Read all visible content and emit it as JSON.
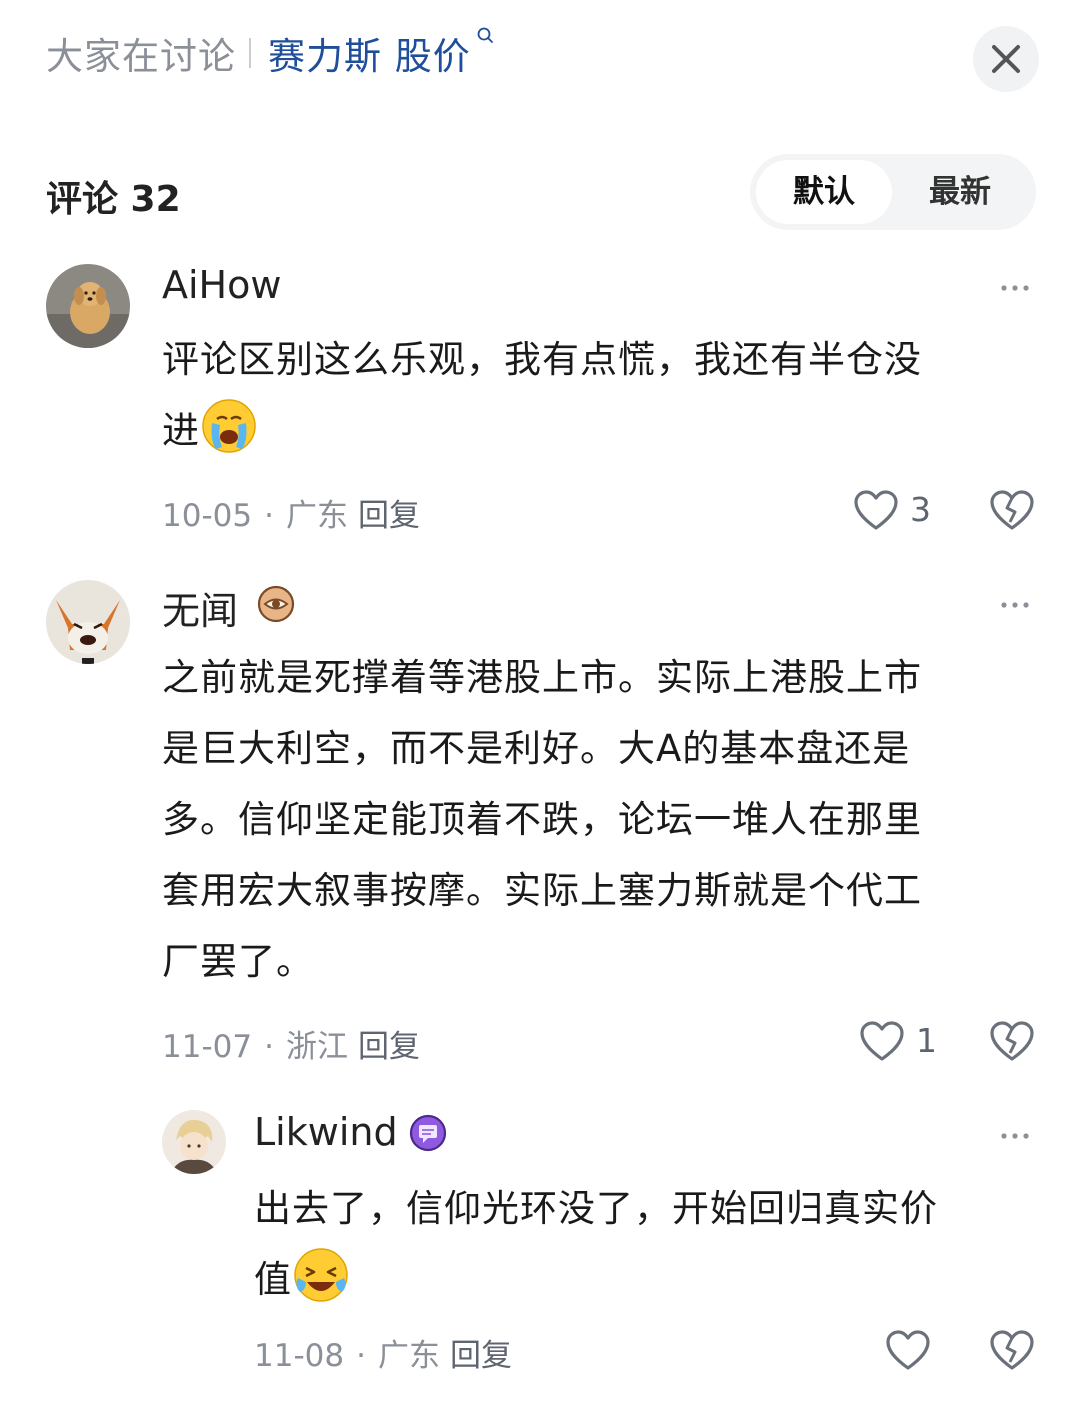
{
  "header": {
    "topic_prefix": "大家在讨论",
    "topic_query": "赛力斯 股价"
  },
  "comments_header": {
    "title": "评论 32",
    "sort_default": "默认",
    "sort_latest": "最新"
  },
  "comments": [
    {
      "username": "AiHow",
      "text_line1": "评论区别这么乐观，我有点慌，我还有半仓没",
      "text_line2": "进",
      "date": "10-05",
      "location": "广东",
      "reply_label": "回复",
      "likes": "3"
    },
    {
      "username": "无闻",
      "lines": [
        "之前就是死撑着等港股上市。实际上港股上市",
        "是巨大利空，而不是利好。大A的基本盘还是",
        "多。信仰坚定能顶着不跌，论坛一堆人在那里",
        "套用宏大叙事按摩。实际上塞力斯就是个代工",
        "厂罢了。"
      ],
      "date": "11-07",
      "location": "浙江",
      "reply_label": "回复",
      "likes": "1"
    },
    {
      "username": "Likwind",
      "text_line1": "出去了，信仰光环没了，开始回归真实价",
      "text_line2": "值",
      "date": "11-08",
      "location": "广东",
      "reply_label": "回复",
      "likes": ""
    }
  ],
  "icons": {
    "close": "close-icon",
    "more": "more-dots-icon",
    "like": "heart-icon",
    "dislike": "broken-heart-icon"
  }
}
